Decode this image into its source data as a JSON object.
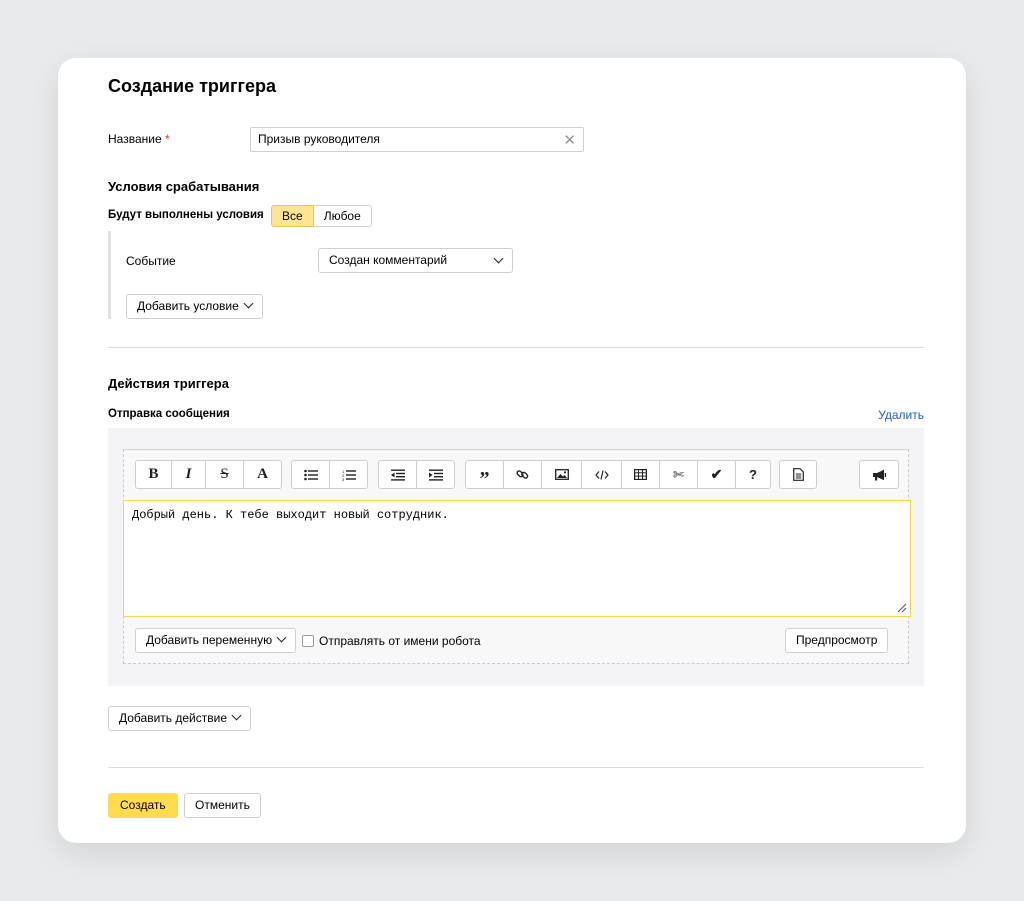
{
  "form": {
    "title": "Создание триггера",
    "name_label": "Название",
    "required_mark": "*",
    "name_value": "Призыв руководителя"
  },
  "conditions": {
    "heading": "Условия срабатывания",
    "match_label": "Будут выполнены условия",
    "match_options": [
      "Все",
      "Любое"
    ],
    "match_selected": "Все",
    "event_label": "Событие",
    "event_value": "Создан комментарий",
    "add_condition": "Добавить условие"
  },
  "actions": {
    "heading": "Действия триггера",
    "action_title": "Отправка сообщения",
    "delete_link": "Удалить",
    "toolbar_icons": [
      "bold-icon",
      "italic-icon",
      "strikethrough-icon",
      "font-color-icon",
      "bulleted-list-icon",
      "numbered-list-icon",
      "outdent-icon",
      "indent-icon",
      "quote-icon",
      "link-icon",
      "image-icon",
      "code-icon",
      "table-icon",
      "cut-icon",
      "checkmark-icon",
      "help-icon",
      "document-icon",
      "megaphone-icon"
    ],
    "toolbar_glyphs": {
      "bold": "B",
      "italic": "I",
      "strike": "S",
      "font": "A",
      "help": "?"
    },
    "message_text": "Добрый день. К тебе выходит новый сотрудник.",
    "add_variable": "Добавить переменную",
    "send_as_robot": "Отправлять от имени робота",
    "send_as_robot_checked": false,
    "preview": "Предпросмотр",
    "add_action": "Добавить действие"
  },
  "buttons": {
    "create": "Создать",
    "cancel": "Отменить"
  },
  "colors": {
    "accent_yellow": "#ffdb4d",
    "segment_active": "#ffe592",
    "link_blue": "#1d5fc9",
    "required_red": "#e53935",
    "editor_focus_border": "#f6d44a"
  }
}
